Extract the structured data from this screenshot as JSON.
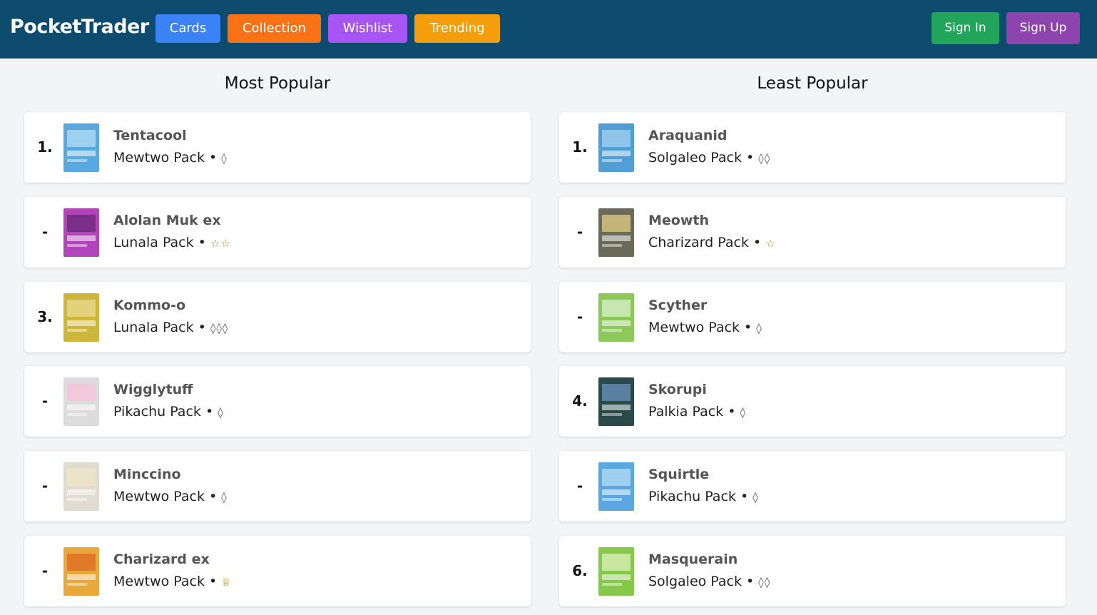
{
  "app": {
    "brand": "PocketTrader",
    "nav": [
      {
        "label": "Cards",
        "color": "#3b82f6"
      },
      {
        "label": "Collection",
        "color": "#f97316"
      },
      {
        "label": "Wishlist",
        "color": "#a855f7"
      },
      {
        "label": "Trending",
        "color": "#f59e0b"
      }
    ],
    "auth": {
      "sign_in": "Sign In",
      "sign_up": "Sign Up",
      "sign_in_color": "#22a55a",
      "sign_up_color": "#8e44ad"
    }
  },
  "most_popular": {
    "title": "Most Popular",
    "items": [
      {
        "rank": "1.",
        "name": "Tentacool",
        "pack": "Mewtwo Pack",
        "rarity": "◊",
        "rarity_type": "diamond",
        "card_color": "#5aa8e0",
        "art_color": "#9fd0f0"
      },
      {
        "rank": "-",
        "name": "Alolan Muk ex",
        "pack": "Lunala Pack",
        "rarity": "☆☆",
        "rarity_type": "star",
        "card_color": "#b044b8",
        "art_color": "#7a2f8a"
      },
      {
        "rank": "3.",
        "name": "Kommo-o",
        "pack": "Lunala Pack",
        "rarity": "◊◊◊",
        "rarity_type": "diamond",
        "card_color": "#cdb63a",
        "art_color": "#e4d27a"
      },
      {
        "rank": "-",
        "name": "Wigglytuff",
        "pack": "Pikachu Pack",
        "rarity": "◊",
        "rarity_type": "diamond",
        "card_color": "#dcdcdc",
        "art_color": "#f2c8dc"
      },
      {
        "rank": "-",
        "name": "Minccino",
        "pack": "Mewtwo Pack",
        "rarity": "◊",
        "rarity_type": "diamond",
        "card_color": "#e0dcd0",
        "art_color": "#ece4c8"
      },
      {
        "rank": "-",
        "name": "Charizard ex",
        "pack": "Mewtwo Pack",
        "rarity": "♕",
        "rarity_type": "star",
        "card_color": "#e8a93a",
        "art_color": "#e07a2a"
      }
    ]
  },
  "least_popular": {
    "title": "Least Popular",
    "items": [
      {
        "rank": "1.",
        "name": "Araquanid",
        "pack": "Solgaleo Pack",
        "rarity": "◊◊",
        "rarity_type": "diamond",
        "card_color": "#4f9fd6",
        "art_color": "#8ec5e8"
      },
      {
        "rank": "-",
        "name": "Meowth",
        "pack": "Charizard Pack",
        "rarity": "☆",
        "rarity_type": "star",
        "card_color": "#6a6a5a",
        "art_color": "#c4b478"
      },
      {
        "rank": "-",
        "name": "Scyther",
        "pack": "Mewtwo Pack",
        "rarity": "◊",
        "rarity_type": "diamond",
        "card_color": "#8cc85a",
        "art_color": "#c8e6b0"
      },
      {
        "rank": "4.",
        "name": "Skorupi",
        "pack": "Palkia Pack",
        "rarity": "◊",
        "rarity_type": "diamond",
        "card_color": "#2a4a4a",
        "art_color": "#5a7fa0"
      },
      {
        "rank": "-",
        "name": "Squirtle",
        "pack": "Pikachu Pack",
        "rarity": "◊",
        "rarity_type": "diamond",
        "card_color": "#5aa8e0",
        "art_color": "#9fd0f0"
      },
      {
        "rank": "6.",
        "name": "Masquerain",
        "pack": "Solgaleo Pack",
        "rarity": "◊◊",
        "rarity_type": "diamond",
        "card_color": "#86c84a",
        "art_color": "#c8e6a0"
      }
    ]
  }
}
